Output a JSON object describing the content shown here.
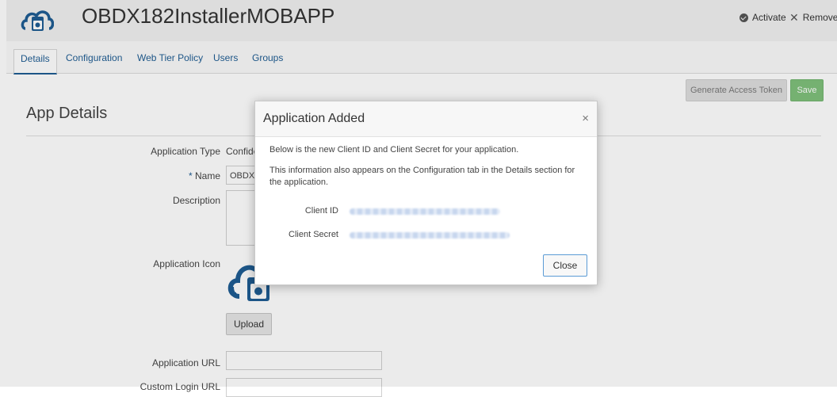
{
  "header": {
    "app_title": "OBDX182InstallerMOBAPP",
    "activate_label": "Activate",
    "remove_label": "Remove"
  },
  "tabs": [
    {
      "label": "Details"
    },
    {
      "label": "Configuration"
    },
    {
      "label": "Web Tier Policy"
    },
    {
      "label": "Users"
    },
    {
      "label": "Groups"
    }
  ],
  "actions": {
    "generate_token_label": "Generate Access Token",
    "save_label": "Save"
  },
  "details": {
    "section_title": "App Details",
    "application_type_label": "Application Type",
    "application_type_value": "Confide",
    "required_mark": "*",
    "name_label": "Name",
    "name_value": "OBDX",
    "description_label": "Description",
    "application_icon_label": "Application Icon",
    "upload_label": "Upload",
    "application_url_label": "Application URL",
    "custom_login_url_label": "Custom Login URL"
  },
  "modal": {
    "title": "Application Added",
    "close_symbol": "×",
    "intro_text": "Below is the new Client ID and Client Secret for your application.",
    "info_text": "This information also appears on the Configuration tab in the Details section for the application.",
    "client_id_label": "Client ID",
    "client_secret_label": "Client Secret",
    "close_button_label": "Close"
  },
  "colors": {
    "link_blue": "#1f5d93",
    "save_green": "#7fc17b",
    "focus_blue": "#5b9bd5"
  }
}
